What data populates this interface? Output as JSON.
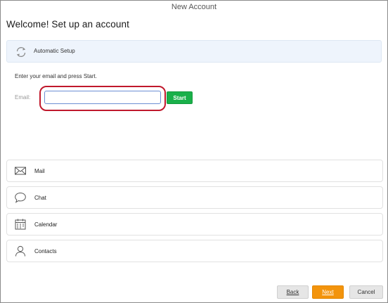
{
  "window": {
    "title": "New Account"
  },
  "heading": "Welcome! Set up an account",
  "automatic_setup": {
    "label": "Automatic Setup",
    "icon": "sync-icon",
    "hint": "Enter your email and press Start.",
    "email_label": "Email:",
    "email_value": "",
    "email_placeholder": "",
    "start_label": "Start"
  },
  "services": [
    {
      "label": "Mail",
      "icon": "envelope-icon"
    },
    {
      "label": "Chat",
      "icon": "speech-bubble-icon"
    },
    {
      "label": "Calendar",
      "icon": "calendar-icon"
    },
    {
      "label": "Contacts",
      "icon": "person-icon"
    }
  ],
  "footer": {
    "back_label": "Back",
    "next_label": "Next",
    "cancel_label": "Cancel"
  },
  "colors": {
    "start_button": "#1ab04a",
    "next_button": "#f3940c",
    "highlight_ring": "#c0182c",
    "setup_panel": "#eef4fc"
  }
}
